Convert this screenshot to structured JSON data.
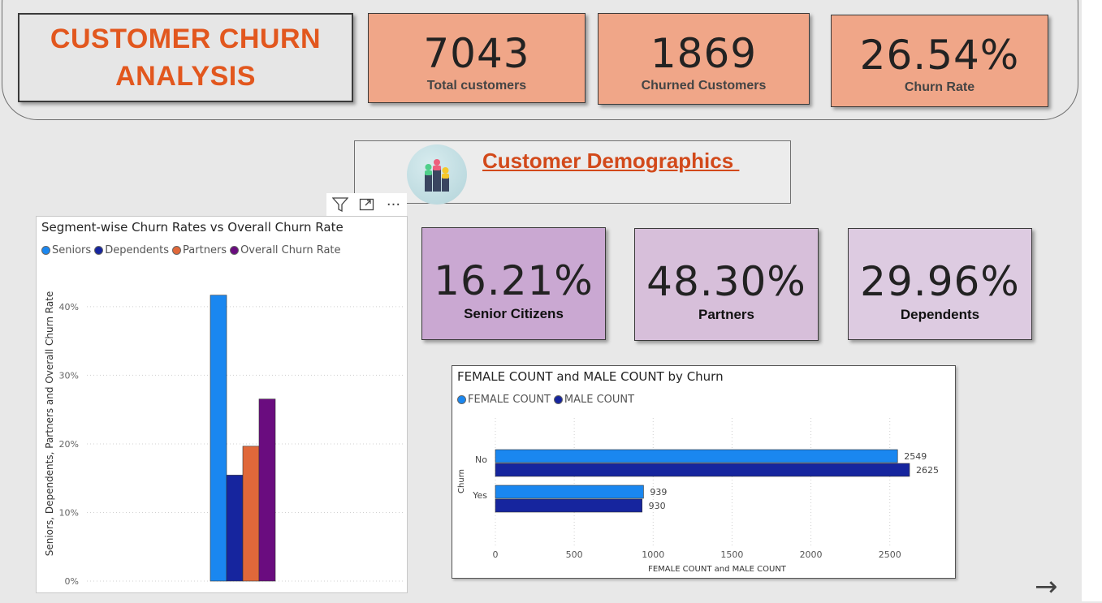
{
  "title": "CUSTOMER CHURN ANALYSIS",
  "kpis": [
    {
      "value": "7043",
      "label": "Total customers"
    },
    {
      "value": "1869",
      "label": "Churned Customers"
    },
    {
      "value": "26.54%",
      "label": "Churn Rate"
    }
  ],
  "demographics_header": "Customer Demographics ",
  "toolbar": {
    "filter_icon": "filter-icon",
    "focus_icon": "focus-mode-icon",
    "more_label": "···"
  },
  "demo_kpis": [
    {
      "value": "16.21%",
      "label": "Senior Citizens",
      "color": "#caa8d2"
    },
    {
      "value": "48.30%",
      "label": "Partners",
      "color": "#d7bfda"
    },
    {
      "value": "29.96%",
      "label": "Dependents",
      "color": "#ddcbe1"
    }
  ],
  "segment_chart": {
    "title": "Segment-wise Churn Rates vs Overall Churn Rate",
    "legend": [
      {
        "name": "Seniors",
        "color": "#1a87f0"
      },
      {
        "name": "Dependents",
        "color": "#16259e"
      },
      {
        "name": "Partners",
        "color": "#e0683a"
      },
      {
        "name": "Overall Churn Rate",
        "color": "#6a0c7f"
      }
    ],
    "ylabel": "Seniors, Dependents, Partners and Overall Churn Rate",
    "yticks": [
      "0%",
      "10%",
      "20%",
      "30%",
      "40%"
    ]
  },
  "gender_chart": {
    "title": "FEMALE COUNT and MALE COUNT by Churn",
    "legend": [
      {
        "name": "FEMALE COUNT",
        "color": "#1a87f0"
      },
      {
        "name": "MALE COUNT",
        "color": "#16259e"
      }
    ],
    "ylabel": "Churn",
    "xlabel": "FEMALE COUNT and MALE COUNT",
    "xticks": [
      "0",
      "500",
      "1000",
      "1500",
      "2000",
      "2500"
    ]
  },
  "chart_data": [
    {
      "type": "bar",
      "title": "Segment-wise Churn Rates vs Overall Churn Rate",
      "ylabel": "Seniors, Dependents, Partners and Overall Churn Rate",
      "ylim": [
        0,
        0.42
      ],
      "series": [
        {
          "name": "Seniors",
          "values": [
            0.4168
          ]
        },
        {
          "name": "Dependents",
          "values": [
            0.1545
          ]
        },
        {
          "name": "Partners",
          "values": [
            0.1966
          ]
        },
        {
          "name": "Overall Churn Rate",
          "values": [
            0.2654
          ]
        }
      ],
      "grid": true,
      "legend_position": "top-left"
    },
    {
      "type": "bar",
      "orientation": "horizontal",
      "title": "FEMALE COUNT and MALE COUNT by Churn",
      "categories": [
        "No",
        "Yes"
      ],
      "series": [
        {
          "name": "FEMALE COUNT",
          "values": [
            2549,
            939
          ]
        },
        {
          "name": "MALE COUNT",
          "values": [
            2625,
            930
          ]
        }
      ],
      "xlabel": "FEMALE COUNT and MALE COUNT",
      "ylabel": "Churn",
      "xlim": [
        0,
        2625
      ],
      "grid": true,
      "legend_position": "top-left"
    }
  ],
  "nav": {
    "next_icon": "arrow-right-icon",
    "next_label": "→"
  }
}
